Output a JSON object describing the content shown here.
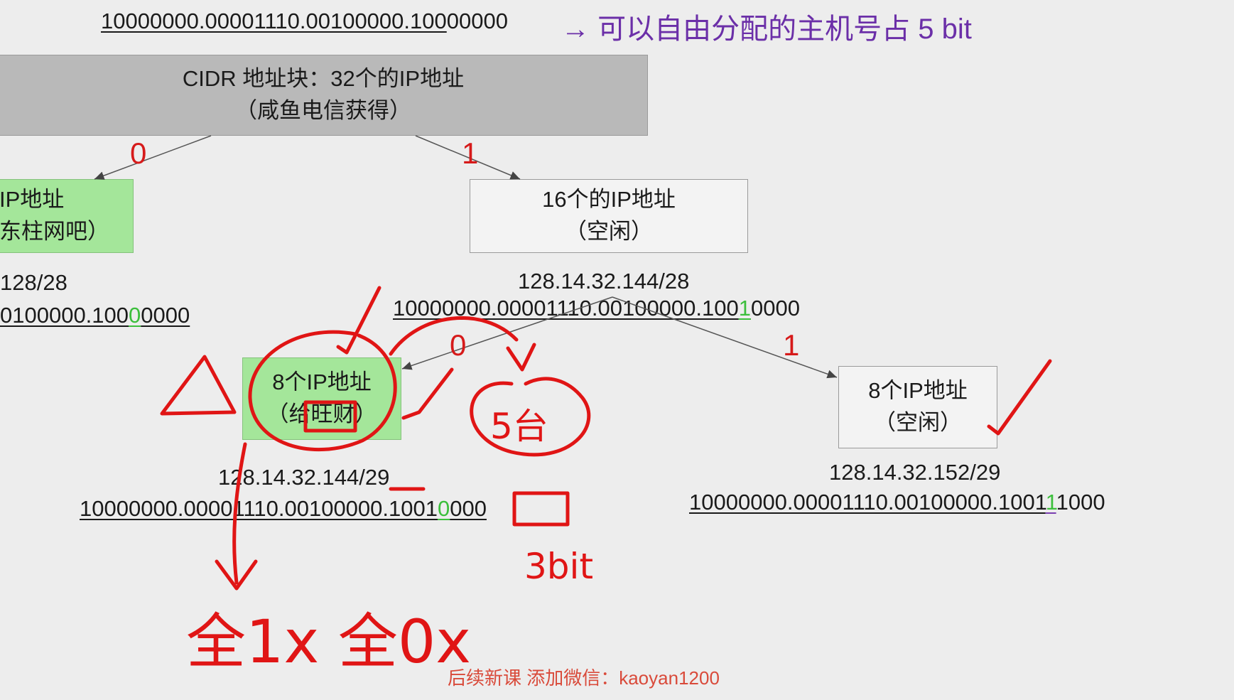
{
  "header": {
    "binary_prefix": "10000000.00001110.00100000.100",
    "binary_suffix": "00000",
    "arrow": "→",
    "note": "可以自由分配的主机号占 5 bit"
  },
  "root": {
    "line1": "CIDR 地址块：32个的IP地址",
    "line2": "（咸鱼电信获得）"
  },
  "left_child": {
    "line1": "IP地址",
    "line2": "东柱网吧）",
    "ip": "128/28",
    "bin_prefix": "0100000.100",
    "bin_bit": "0",
    "bin_suffix": "0000"
  },
  "right_child": {
    "line1": "16个的IP地址",
    "line2": "（空闲）",
    "ip": "128.14.32.144/28",
    "bin_prefix": "10000000.00001110.00100000.100",
    "bin_bit": "1",
    "bin_suffix": "0000"
  },
  "grand_left": {
    "line1": "8个IP地址",
    "line2": "（给旺财）",
    "ip": "128.14.32.144/29",
    "bin_prefix": "10000000.00001110.00100000.1001",
    "bin_bit": "0",
    "bin_suffix": "000"
  },
  "grand_right": {
    "line1": "8个IP地址",
    "line2": "（空闲）",
    "ip": "128.14.32.152/29",
    "bin_prefix": "10000000.00001110.00100000.1001",
    "bin_bit": "1",
    "bin_suffix": "1000"
  },
  "branch_labels": {
    "root_left": "0",
    "root_right": "1",
    "mid_left": "0",
    "mid_right": "1"
  },
  "annotations": {
    "count": "5台",
    "bits": "3bit",
    "bottom": "全1x 全0x"
  },
  "watermark": "后续新课 添加微信：kaoyan1200",
  "colors": {
    "accent_red": "#d61a1a",
    "note_purple": "#6b2fa8",
    "green_box": "#a4e69a",
    "gray_box": "#b9b9b9"
  }
}
